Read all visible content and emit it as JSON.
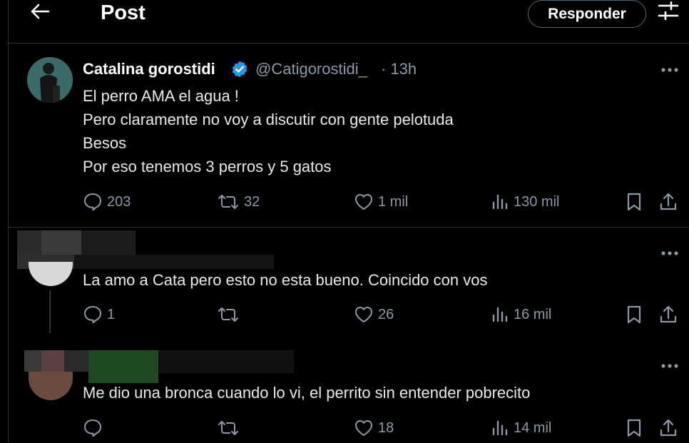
{
  "header": {
    "title": "Post",
    "reply_button": "Responder",
    "back_icon": "arrow-left-icon",
    "filter_icon": "sliders-icon"
  },
  "main_post": {
    "name": "Catalina gorostidi",
    "handle": "@Catigorostidi_",
    "time": "· 13h",
    "lines": [
      "El perro AMA el agua !",
      "Pero claramente no voy a discutir con gente pelotuda",
      "Besos",
      "Por eso tenemos 3 perros y 5 gatos"
    ],
    "stats": {
      "replies": "203",
      "reposts": "32",
      "likes": "1 mil",
      "views": "130 mil"
    }
  },
  "replies": [
    {
      "text": "La amo a Cata pero esto no esta bueno. Coincido con vos",
      "stats": {
        "replies": "1",
        "reposts": "",
        "likes": "26",
        "views": "16 mil"
      }
    },
    {
      "text": "Me dio una bronca cuando lo vi, el perrito sin entender pobrecito",
      "stats": {
        "replies": "",
        "reposts": "",
        "likes": "18",
        "views": "14 mil"
      }
    }
  ],
  "colors": {
    "background": "#000000",
    "text": "#e7e9ea",
    "muted": "#8b98a5",
    "verified": "#1d9bf0",
    "border": "#2f3336"
  }
}
